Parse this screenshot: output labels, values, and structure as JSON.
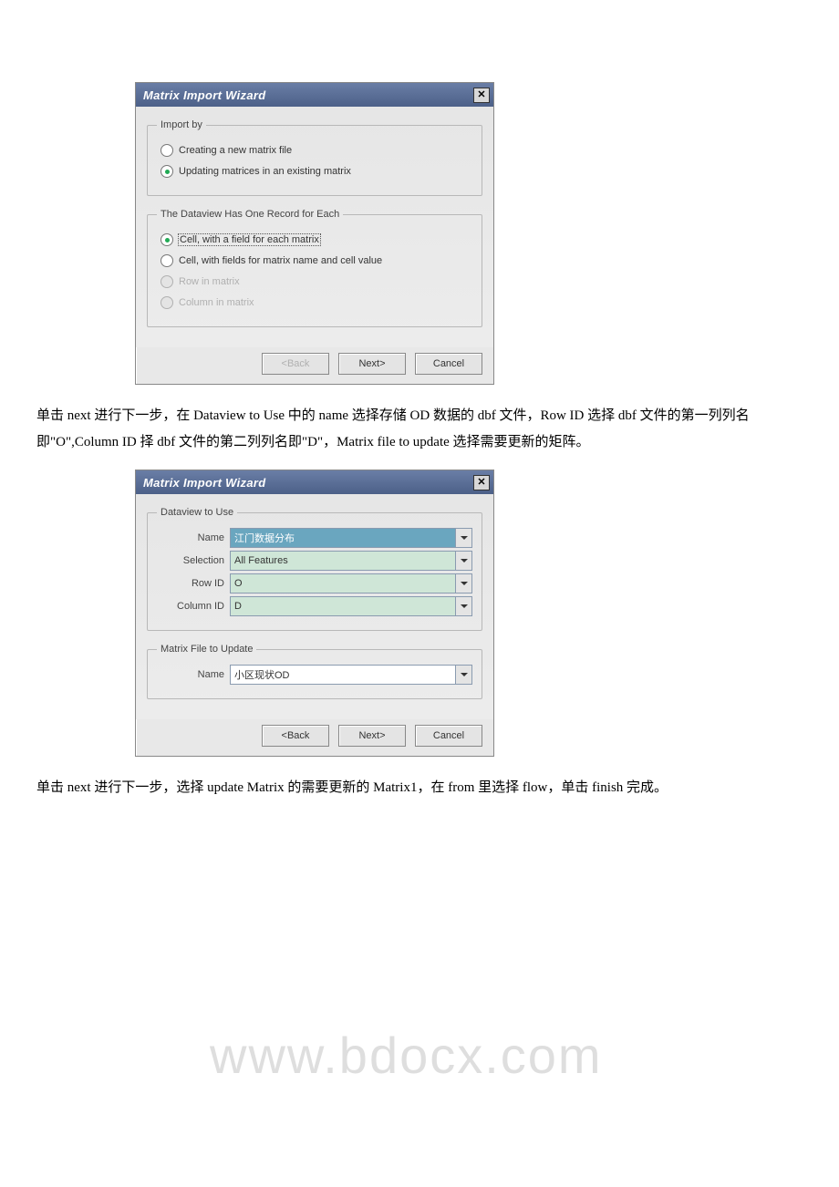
{
  "watermark": "www.bdocx.com",
  "dialog1": {
    "title": "Matrix Import Wizard",
    "close": "✕",
    "group_import_by": {
      "legend": "Import by",
      "opt_create": "Creating a new matrix file",
      "opt_update": "Updating matrices in an existing matrix"
    },
    "group_dataview": {
      "legend": "The Dataview Has One Record for Each",
      "opt_cell_field": "Cell, with a field for each matrix",
      "opt_cell_named": "Cell, with fields for matrix name and cell value",
      "opt_row": "Row in matrix",
      "opt_col": "Column in matrix"
    },
    "buttons": {
      "back": "<Back",
      "next": "Next>",
      "cancel": "Cancel"
    }
  },
  "para1": "        单击 next 进行下一步，在 Dataview to Use 中的 name 选择存储 OD 数据的 dbf 文件，Row ID 选择 dbf 文件的第一列列名即\"O\",Column ID 择 dbf 文件的第二列列名即\"D\"，Matrix file to update 选择需要更新的矩阵。",
  "dialog2": {
    "title": "Matrix Import Wizard",
    "close": "✕",
    "group_dataview_to_use": {
      "legend": "Dataview to Use",
      "fields": {
        "name": {
          "label": "Name",
          "value": "江门数据分布"
        },
        "selection": {
          "label": "Selection",
          "value": "All Features"
        },
        "row_id": {
          "label": "Row ID",
          "value": "O"
        },
        "column_id": {
          "label": "Column ID",
          "value": "D"
        }
      }
    },
    "group_matrix_file": {
      "legend": "Matrix File to Update",
      "fields": {
        "name": {
          "label": "Name",
          "value": "小区现状OD"
        }
      }
    },
    "buttons": {
      "back": "<Back",
      "next": "Next>",
      "cancel": "Cancel"
    }
  },
  "para2": "        单击 next 进行下一步，选择 update Matrix 的需要更新的 Matrix1，在 from 里选择 flow，单击 finish 完成。"
}
